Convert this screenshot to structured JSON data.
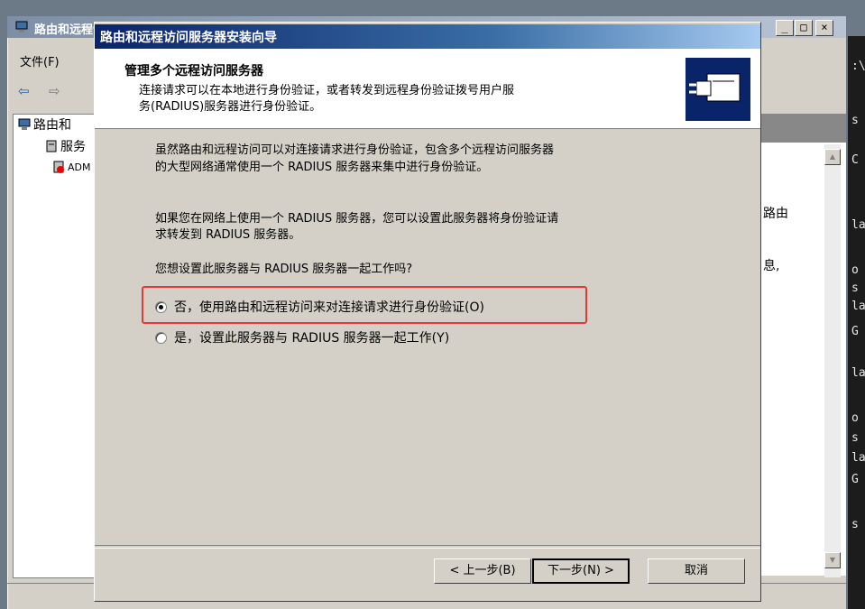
{
  "background_window": {
    "title": "路由和远程访问",
    "menu_file": "文件(F)",
    "tree_root": "路由和",
    "tree_child_1": "服务",
    "tree_child_2": "ADM",
    "right_text_route": "路由",
    "right_text_info": "息,",
    "caption_min": "_",
    "caption_max": "□",
    "caption_close": "×"
  },
  "terminal_lines": [
    ":\\",
    "s",
    "C",
    "la",
    "o",
    "s",
    "la",
    "G",
    "la",
    "o",
    "s",
    "la",
    "G",
    "s"
  ],
  "wizard": {
    "title": "路由和远程访问服务器安装向导",
    "heading": "管理多个远程访问服务器",
    "subtitle_line1": "连接请求可以在本地进行身份验证，或者转发到远程身份验证拨号用户服",
    "subtitle_line2": "务(RADIUS)服务器进行身份验证。",
    "para1_line1": "虽然路由和远程访问可以对连接请求进行身份验证，包含多个远程访问服务器",
    "para1_line2": "的大型网络通常使用一个 RADIUS 服务器来集中进行身份验证。",
    "para2_line1": "如果您在网络上使用一个 RADIUS 服务器，您可以设置此服务器将身份验证请",
    "para2_line2": "求转发到 RADIUS 服务器。",
    "question": "您想设置此服务器与 RADIUS 服务器一起工作吗?",
    "options": [
      {
        "label": "否，使用路由和远程访问来对连接请求进行身份验证(O)",
        "selected": true
      },
      {
        "label": "是，设置此服务器与 RADIUS 服务器一起工作(Y)",
        "selected": false
      }
    ],
    "buttons": {
      "back": "< 上一步(B)",
      "next": "下一步(N) >",
      "cancel": "取消"
    }
  },
  "colors": {
    "title_active": "#0a246a",
    "highlight": "#e53935"
  }
}
